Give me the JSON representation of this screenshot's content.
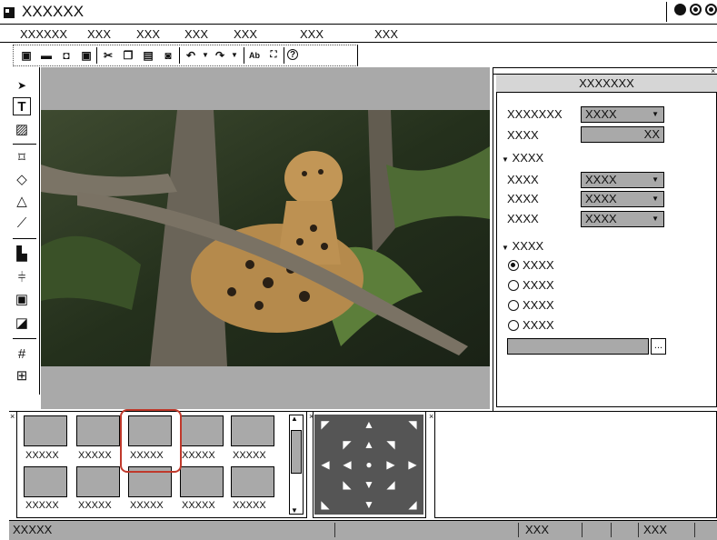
{
  "window": {
    "title": "XXXXXX"
  },
  "menu": [
    "XXXXXX",
    "XXX",
    "XXX",
    "XXX",
    "XXX",
    "XXX",
    "XXX"
  ],
  "panel": {
    "title": "XXXXXXX",
    "row1_label": "XXXXXXX",
    "row1_value": "XXXX",
    "row2_label": "XXXX",
    "row2_value": "XX",
    "section1": "XXXX",
    "s1_rows": [
      {
        "label": "XXXX",
        "value": "XXXX"
      },
      {
        "label": "XXXX",
        "value": "XXXX"
      },
      {
        "label": "XXXX",
        "value": "XXXX"
      }
    ],
    "section2": "XXXX",
    "radios": [
      {
        "label": "XXXX",
        "selected": true
      },
      {
        "label": "XXXX",
        "selected": false
      },
      {
        "label": "XXXX",
        "selected": false
      },
      {
        "label": "XXXX",
        "selected": false
      }
    ],
    "browse_label": "..."
  },
  "thumbnails": {
    "row1": [
      "XXXXX",
      "XXXXX",
      "XXXXX",
      "XXXXX",
      "XXXXX"
    ],
    "row2": [
      "XXXXX",
      "XXXXX",
      "XXXXX",
      "XXXXX",
      "XXXXX"
    ]
  },
  "status": {
    "left": "XXXXX",
    "mid": "XXX",
    "right": "XXX"
  }
}
